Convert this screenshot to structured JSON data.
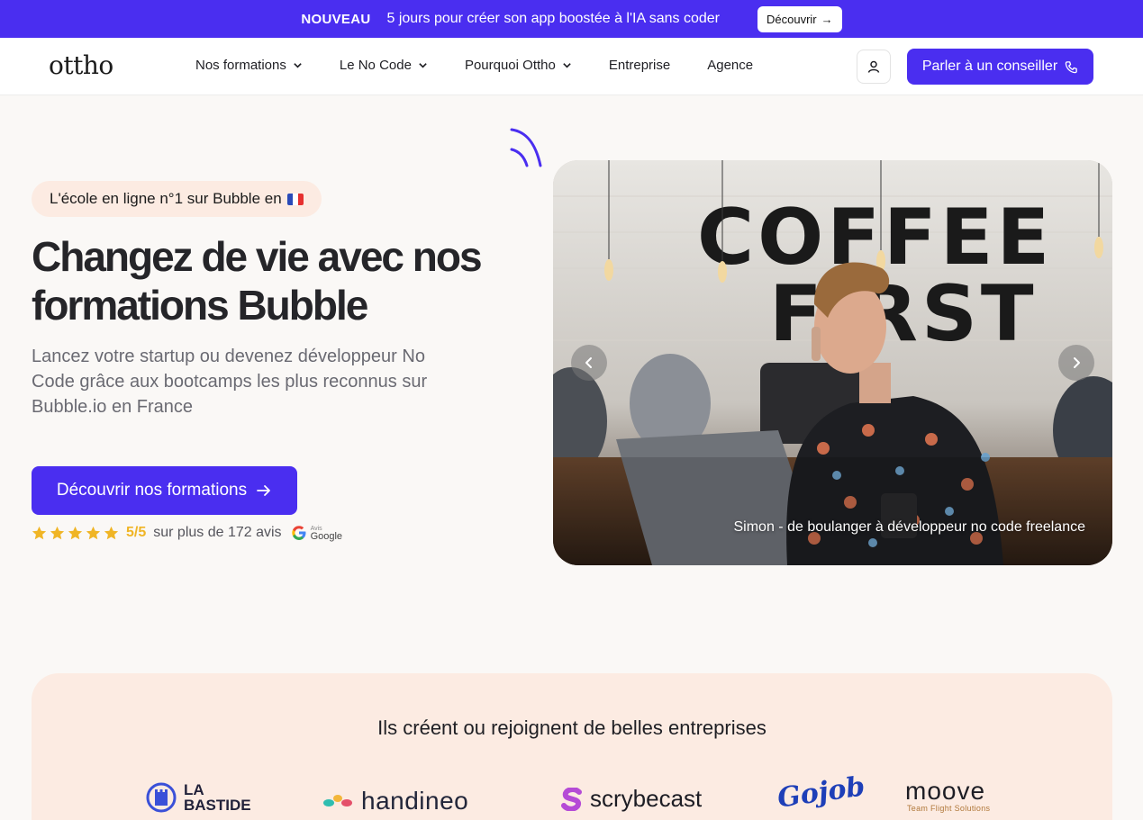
{
  "announcement": {
    "tag": "NOUVEAU",
    "message": "5 jours pour créer son app boostée à l'IA sans coder",
    "cta": "Découvrir",
    "cta_arrow": "→"
  },
  "header": {
    "logo": "ottho",
    "nav": [
      {
        "label": "Nos formations",
        "dropdown": true
      },
      {
        "label": "Le No Code",
        "dropdown": true
      },
      {
        "label": "Pourquoi Ottho",
        "dropdown": true
      },
      {
        "label": "Entreprise",
        "dropdown": false
      },
      {
        "label": "Agence",
        "dropdown": false
      }
    ],
    "user_icon": "user-icon",
    "advisor_button": "Parler à un conseiller",
    "advisor_icon": "phone-icon"
  },
  "hero": {
    "badge": "L'école en ligne n°1 sur Bubble en",
    "badge_flag": "france-flag-icon",
    "title": "Changez de vie avec nos formations Bubble",
    "subtitle": "Lancez votre startup ou devenez développeur No Code grâce aux bootcamps les plus reconnus sur Bubble.io en France",
    "cta": "Découvrir nos formations",
    "rating": {
      "stars": 5,
      "score": "5/5",
      "text": "sur plus de 172 avis",
      "google_small": "Avis",
      "google_label": "Google"
    },
    "carousel": {
      "caption": "Simon - de boulanger à développeur no code freelance",
      "image_sign": "COFFEE FIRST"
    }
  },
  "companies": {
    "title": "Ils créent ou rejoignent de belles entreprises",
    "logos": {
      "bastide_line1": "LA",
      "bastide_line2": "BASTIDE",
      "handineo": "handineo",
      "scrybecast": "scrybecast",
      "gojob": "Gojob",
      "moove": "moove",
      "moove_tagline": "Team Flight Solutions"
    }
  },
  "colors": {
    "brand": "#4a2ef0",
    "badge_bg": "#fcebe2",
    "star": "#f0b525"
  }
}
